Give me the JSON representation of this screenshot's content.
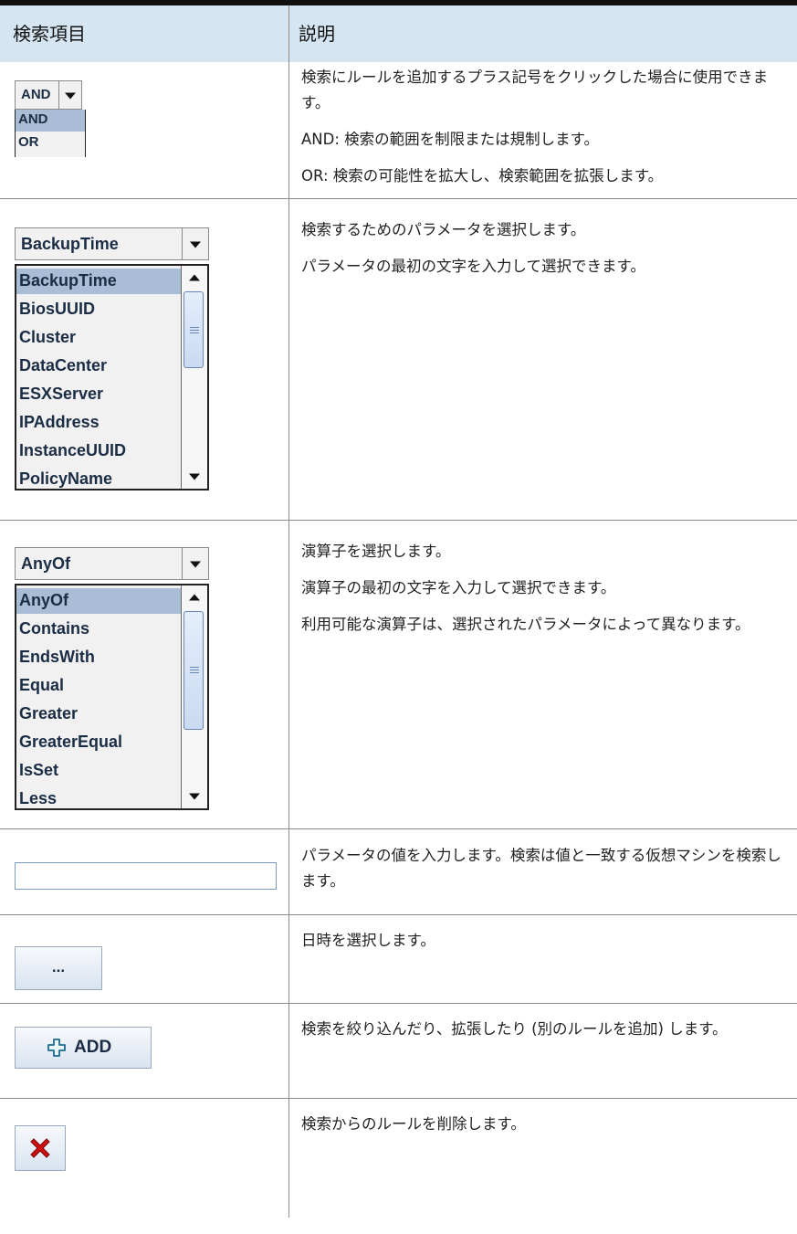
{
  "table": {
    "headers": {
      "col1": "検索項目",
      "col2": "説明"
    }
  },
  "rows": {
    "andor": {
      "combo_value": "AND",
      "options": [
        "AND",
        "OR"
      ],
      "desc": [
        "検索にルールを追加するプラス記号をクリックした場合に使用できます。",
        "AND: 検索の範囲を制限または規制します。",
        "OR: 検索の可能性を拡大し、検索範囲を拡張します。"
      ]
    },
    "parameter": {
      "combo_value": "BackupTime",
      "options": [
        "BackupTime",
        "BiosUUID",
        "Cluster",
        "DataCenter",
        "ESXServer",
        "IPAddress",
        "InstanceUUID",
        "PolicyName"
      ],
      "desc": [
        "検索するためのパラメータを選択します。",
        "パラメータの最初の文字を入力して選択できます。"
      ]
    },
    "operator": {
      "combo_value": "AnyOf",
      "options": [
        "AnyOf",
        "Contains",
        "EndsWith",
        "Equal",
        "Greater",
        "GreaterEqual",
        "IsSet",
        "Less"
      ],
      "desc": [
        "演算子を選択します。",
        "演算子の最初の文字を入力して選択できます。",
        "利用可能な演算子は、選択されたパラメータによって異なります。"
      ]
    },
    "value": {
      "input_value": "",
      "desc": [
        "パラメータの値を入力します。検索は値と一致する仮想マシンを検索します。"
      ]
    },
    "datetime": {
      "button_label": "...",
      "desc": [
        "日時を選択します。"
      ]
    },
    "add": {
      "button_label": "ADD",
      "icon": "plus-icon",
      "desc": [
        "検索を絞り込んだり、拡張したり (別のルールを追加) します。"
      ]
    },
    "remove": {
      "icon": "red-x-icon",
      "icon_color": "#d01010",
      "desc": [
        "検索からのルールを削除します。"
      ]
    }
  },
  "colors": {
    "header_bg": "#d5e6f2",
    "selection": "#a9bdd6"
  }
}
